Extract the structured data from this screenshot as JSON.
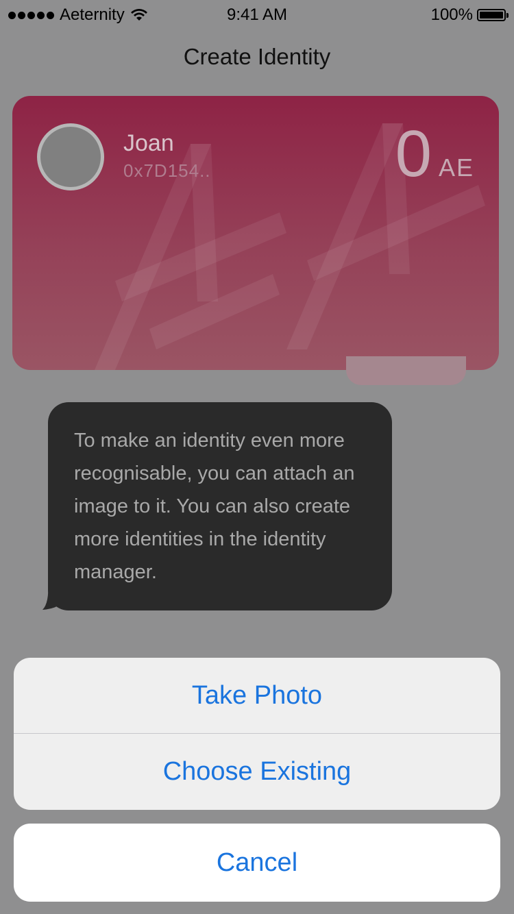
{
  "status_bar": {
    "carrier": "Aeternity",
    "time": "9:41 AM",
    "battery": "100%"
  },
  "header": {
    "title": "Create Identity"
  },
  "card": {
    "name": "Joan",
    "address": "0x7D154..",
    "balance": "0",
    "unit": "AE",
    "watermark": "AE"
  },
  "tooltip": {
    "text": "To make an identity even more recognisable, you can attach an image to it. You can also create more identities in the identity manager."
  },
  "action_sheet": {
    "take_photo": "Take Photo",
    "choose_existing": "Choose Existing",
    "cancel": "Cancel"
  },
  "colors": {
    "accent": "#1a74de",
    "card_top": "#8e2345",
    "card_bottom": "#9a5564",
    "tooltip_bg": "#2a2a2a"
  },
  "icons": [
    "signal-dots-icon",
    "wifi-icon",
    "battery-icon",
    "avatar-placeholder",
    "ae-watermark"
  ]
}
